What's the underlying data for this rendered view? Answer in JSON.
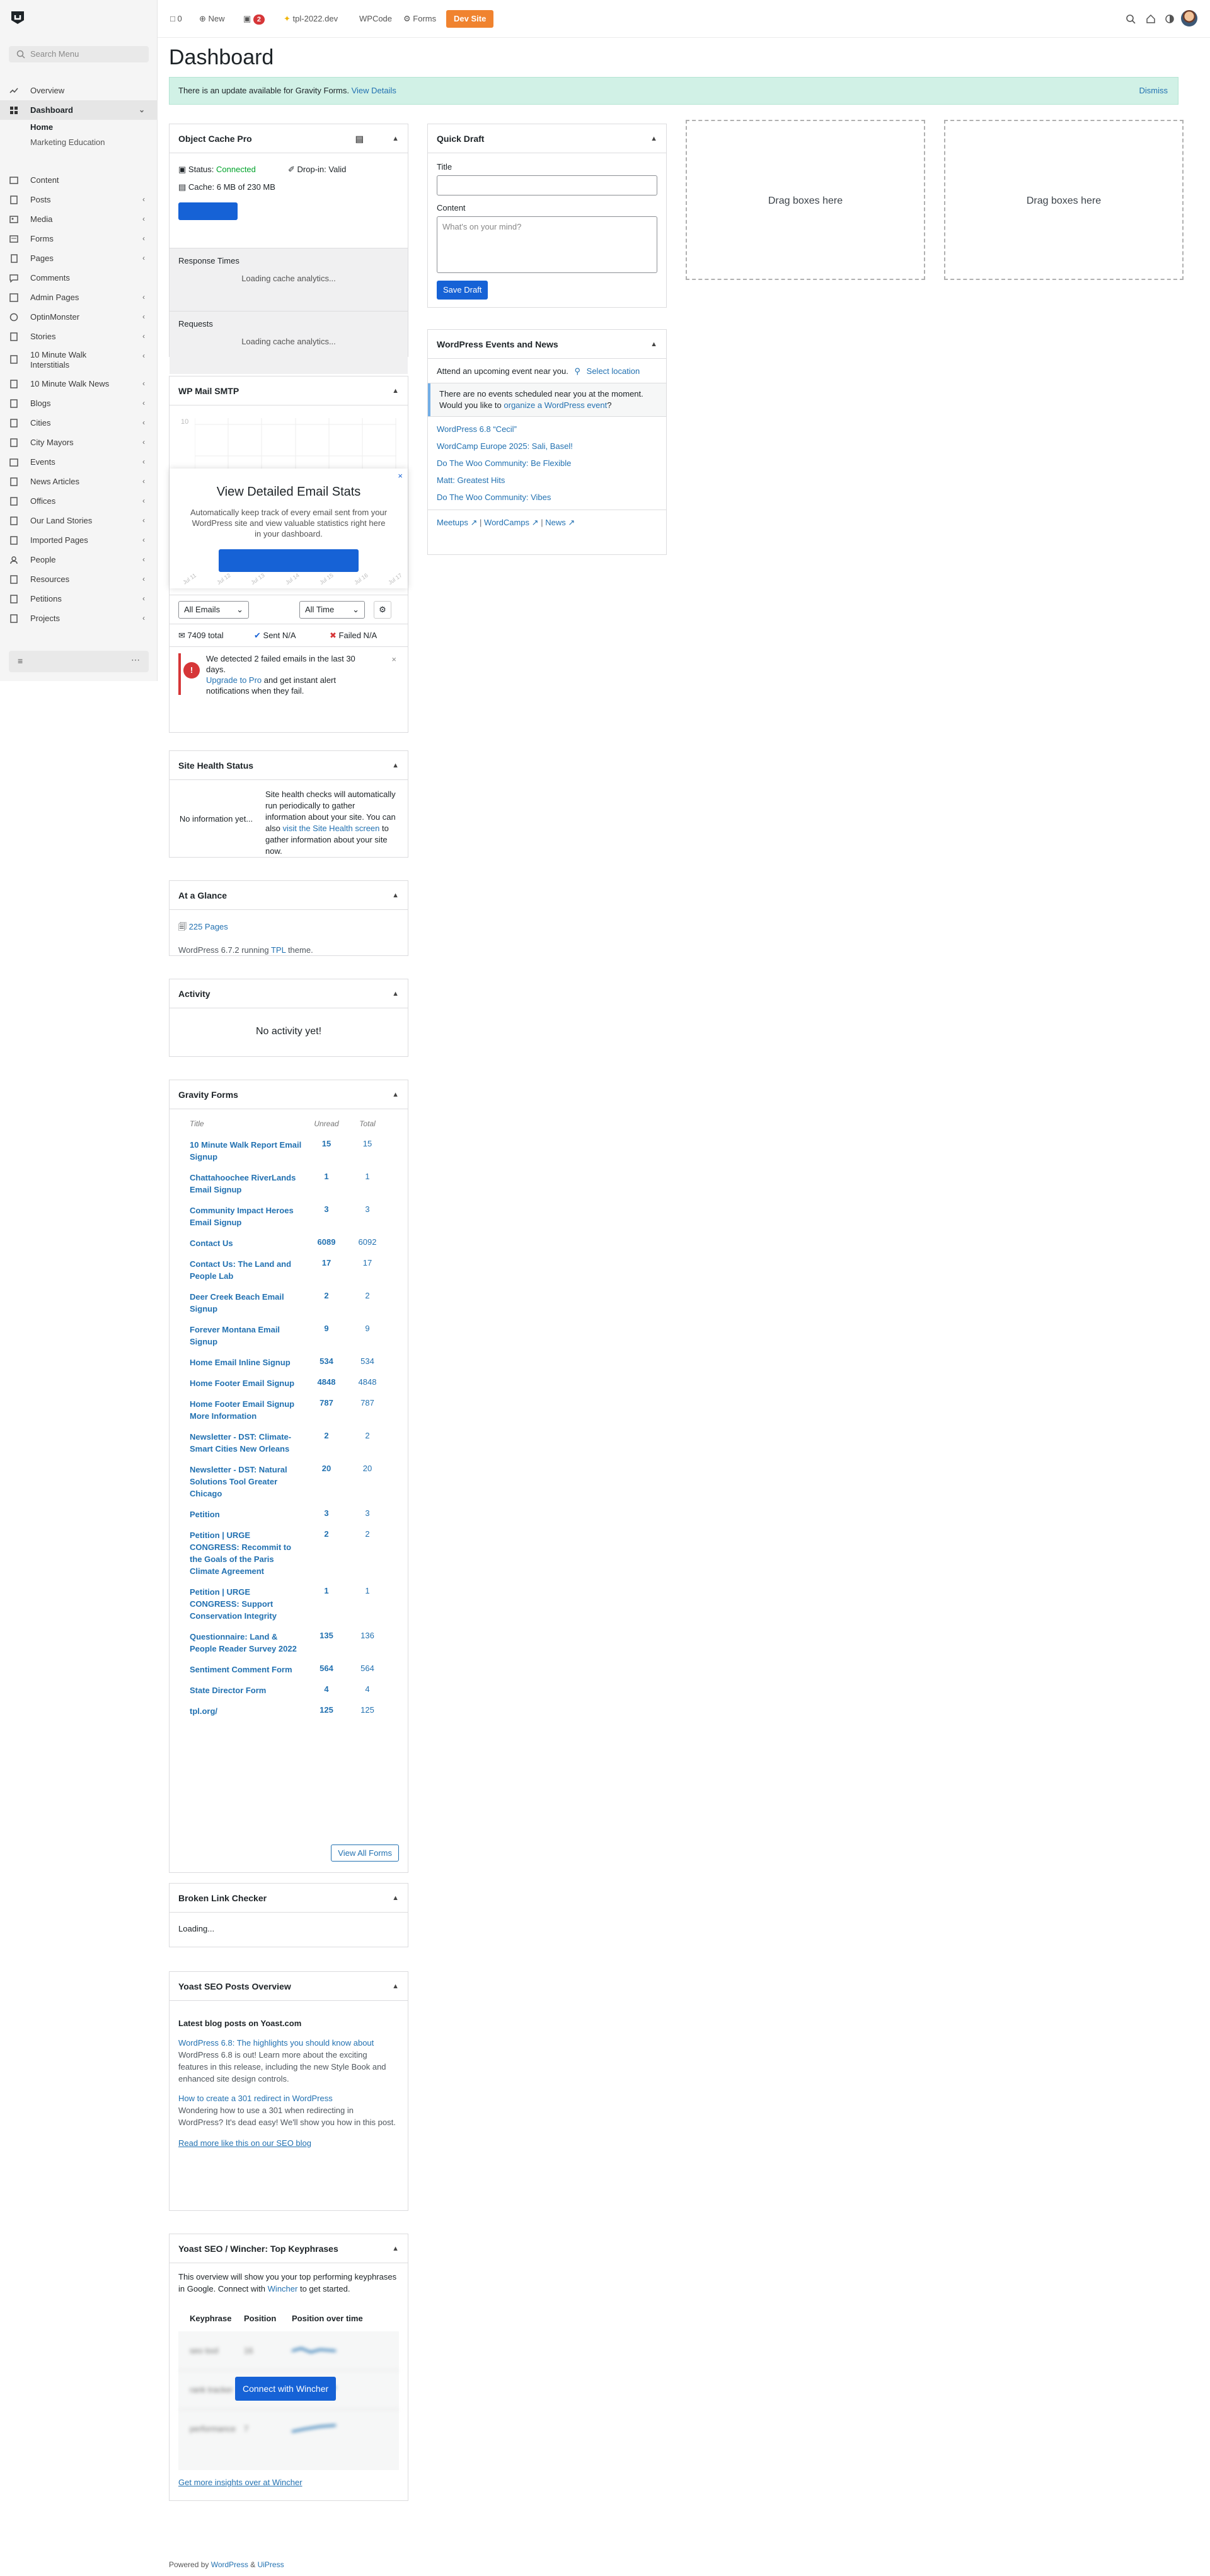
{
  "topbar": {
    "comments_count": "0",
    "new_label": "New",
    "updates_count": "2",
    "site_name": "tpl-2022.dev",
    "wpcode_label": "WPCode",
    "forms_label": "Forms",
    "dev_site_label": "Dev Site"
  },
  "sidebar": {
    "search_placeholder": "Search Menu",
    "items": [
      {
        "label": "Overview"
      },
      {
        "label": "Dashboard"
      },
      {
        "label": "Home"
      },
      {
        "label": "Marketing Education"
      },
      {
        "label": "Content"
      },
      {
        "label": "Posts"
      },
      {
        "label": "Media"
      },
      {
        "label": "Forms"
      },
      {
        "label": "Pages"
      },
      {
        "label": "Comments"
      },
      {
        "label": "Admin Pages"
      },
      {
        "label": "OptinMonster"
      },
      {
        "label": "Stories"
      },
      {
        "label": "10 Minute Walk Interstitials"
      },
      {
        "label": "10 Minute Walk News"
      },
      {
        "label": "Blogs"
      },
      {
        "label": "Cities"
      },
      {
        "label": "City Mayors"
      },
      {
        "label": "Events"
      },
      {
        "label": "News Articles"
      },
      {
        "label": "Offices"
      },
      {
        "label": "Our Land Stories"
      },
      {
        "label": "Imported Pages"
      },
      {
        "label": "People"
      },
      {
        "label": "Resources"
      },
      {
        "label": "Petitions"
      },
      {
        "label": "Projects"
      }
    ]
  },
  "page": {
    "title": "Dashboard",
    "notice_text": "There is an update available for Gravity Forms.",
    "notice_link": "View Details",
    "notice_dismiss": "Dismiss",
    "drag_boxes": "Drag boxes here"
  },
  "object_cache": {
    "title": "Object Cache Pro",
    "status_label": "Status:",
    "status_value": "Connected",
    "dropin": "Drop-in: Valid",
    "cache": "Cache: 6 MB of 230 MB",
    "response_times": "Response Times",
    "requests": "Requests",
    "loading": "Loading cache analytics..."
  },
  "wp_mail": {
    "title": "WP Mail SMTP",
    "overlay_title": "View Detailed Email Stats",
    "overlay_text": "Automatically keep track of every email sent from your WordPress site and view valuable statistics right here in your dashboard.",
    "y_tick": "10",
    "x_ticks": [
      "Jul 11",
      "Jul 12",
      "Jul 13",
      "Jul 14",
      "Jul 15",
      "Jul 16",
      "Jul 17"
    ],
    "filter_emails": "All Emails",
    "filter_time": "All Time",
    "total": "7409 total",
    "sent": "Sent N/A",
    "failed": "Failed N/A",
    "alert_text": "We detected 2 failed emails in the last 30 days.",
    "alert_link": "Upgrade to Pro",
    "alert_rest": "and get instant alert notifications when they fail."
  },
  "site_health": {
    "title": "Site Health Status",
    "no_info": "No information yet...",
    "text1": "Site health checks will automatically run periodically to gather information about your site. You can also",
    "link": "visit the Site Health screen",
    "text2": "to gather information about your site now."
  },
  "glance": {
    "title": "At a Glance",
    "pages": "225 Pages",
    "version_pre": "WordPress 6.7.2 running",
    "theme": "TPL",
    "version_post": "theme."
  },
  "activity": {
    "title": "Activity",
    "empty": "No activity yet!"
  },
  "gravity": {
    "title": "Gravity Forms",
    "col_title": "Title",
    "col_unread": "Unread",
    "col_total": "Total",
    "rows": [
      {
        "title": "10 Minute Walk Report Email Signup",
        "unread": "15",
        "total": "15"
      },
      {
        "title": "Chattahoochee RiverLands Email Signup",
        "unread": "1",
        "total": "1"
      },
      {
        "title": "Community Impact Heroes Email Signup",
        "unread": "3",
        "total": "3"
      },
      {
        "title": "Contact Us",
        "unread": "6089",
        "total": "6092"
      },
      {
        "title": "Contact Us: The Land and People Lab",
        "unread": "17",
        "total": "17"
      },
      {
        "title": "Deer Creek Beach Email Signup",
        "unread": "2",
        "total": "2"
      },
      {
        "title": "Forever Montana Email Signup",
        "unread": "9",
        "total": "9"
      },
      {
        "title": "Home Email Inline Signup",
        "unread": "534",
        "total": "534"
      },
      {
        "title": "Home Footer Email Signup",
        "unread": "4848",
        "total": "4848"
      },
      {
        "title": "Home Footer Email Signup More Information",
        "unread": "787",
        "total": "787"
      },
      {
        "title": "Newsletter - DST: Climate-Smart Cities New Orleans",
        "unread": "2",
        "total": "2"
      },
      {
        "title": "Newsletter - DST: Natural Solutions Tool Greater Chicago",
        "unread": "20",
        "total": "20"
      },
      {
        "title": "Petition",
        "unread": "3",
        "total": "3"
      },
      {
        "title": "Petition | URGE CONGRESS: Recommit to the Goals of the Paris Climate Agreement",
        "unread": "2",
        "total": "2"
      },
      {
        "title": "Petition | URGE CONGRESS: Support Conservation Integrity",
        "unread": "1",
        "total": "1"
      },
      {
        "title": "Questionnaire: Land & People Reader Survey 2022",
        "unread": "135",
        "total": "136"
      },
      {
        "title": "Sentiment Comment Form",
        "unread": "564",
        "total": "564"
      },
      {
        "title": "State Director Form",
        "unread": "4",
        "total": "4"
      },
      {
        "title": "tpl.org/",
        "unread": "125",
        "total": "125"
      }
    ],
    "view_all": "View All Forms"
  },
  "broken_link": {
    "title": "Broken Link Checker",
    "loading": "Loading..."
  },
  "yoast_posts": {
    "title": "Yoast SEO Posts Overview",
    "latest": "Latest blog posts on Yoast.com",
    "post1_title": "WordPress 6.8: The highlights you should know about",
    "post1_text": "WordPress 6.8 is out! Learn more about the exciting features in this release, including the new Style Book and enhanced site design controls.",
    "post2_title": "How to create a 301 redirect in WordPress",
    "post2_text": "Wondering how to use a 301 when redirecting in WordPress? It's dead easy! We'll show you how in this post.",
    "read_more": "Read more like this on our SEO blog"
  },
  "yoast_wincher": {
    "title": "Yoast SEO / Wincher: Top Keyphrases",
    "intro_pre": "This overview will show you your top performing keyphrases in Google. Connect with",
    "intro_link": "Wincher",
    "intro_post": "to get started.",
    "col_keyphrase": "Keyphrase",
    "col_position": "Position",
    "col_over_time": "Position over time",
    "rows": [
      {
        "keyphrase": "seo tool",
        "position": "16"
      },
      {
        "keyphrase": "rank tracker",
        "position": "10"
      },
      {
        "keyphrase": "performance",
        "position": "7"
      }
    ],
    "connect": "Connect with Wincher",
    "more": "Get more insights over at Wincher"
  },
  "quick_draft": {
    "title": "Quick Draft",
    "title_label": "Title",
    "content_label": "Content",
    "content_placeholder": "What's on your mind?",
    "save": "Save Draft"
  },
  "events": {
    "title": "WordPress Events and News",
    "attend": "Attend an upcoming event near you.",
    "select_location": "Select location",
    "no_events_pre": "There are no events scheduled near you at the moment. Would you like to",
    "no_events_link": "organize a WordPress event",
    "no_events_post": "?",
    "news": [
      "WordPress 6.8 “Cecil”",
      "WordCamp Europe 2025: Sali, Basel!",
      "Do The Woo Community: Be Flexible",
      "Matt: Greatest Hits",
      "Do The Woo Community: Vibes"
    ],
    "meetups": "Meetups",
    "wordcamps": "WordCamps",
    "news_link": "News"
  },
  "footer": {
    "powered": "Powered by",
    "wp": "WordPress",
    "amp": "&",
    "uipress": "UiPress"
  },
  "colors": {
    "accent": "#1662d6",
    "dev_site": "#f0832f",
    "notice_bg": "#d1f1e6",
    "error": "#d63638",
    "connected": "#00a32a"
  }
}
